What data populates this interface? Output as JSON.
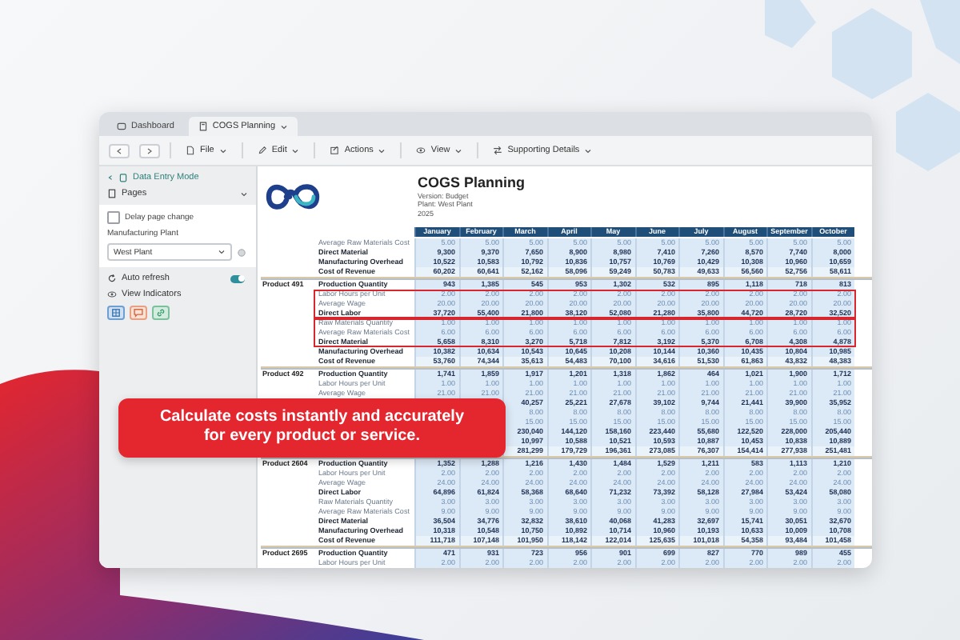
{
  "tabs": [
    {
      "label": "Dashboard",
      "selected": false
    },
    {
      "label": "COGS Planning",
      "selected": true
    }
  ],
  "toolbar": [
    {
      "label": "File",
      "kind": "file"
    },
    {
      "label": "Edit",
      "kind": "edit"
    },
    {
      "label": "Actions",
      "kind": "actions"
    },
    {
      "label": "View",
      "kind": "view"
    },
    {
      "label": "Supporting Details",
      "kind": "details"
    }
  ],
  "sidebar": {
    "mode_label": "Data Entry Mode",
    "pages_label": "Pages",
    "delay_page_change": {
      "label": "Delay page change",
      "checked": false
    },
    "plant_field": {
      "label": "Manufacturing Plant",
      "value": "West Plant"
    },
    "auto_refresh": {
      "label": "Auto refresh",
      "on": true
    },
    "view_indicators": {
      "label": "View Indicators"
    }
  },
  "report": {
    "title": "COGS Planning",
    "version": "Version: Budget",
    "plant": "Plant: West Plant",
    "year": "2025"
  },
  "columns": [
    "January",
    "February",
    "March",
    "April",
    "May",
    "June",
    "July",
    "August",
    "September",
    "October"
  ],
  "groups": [
    {
      "rows": [
        {
          "label": "Average Raw Materials Cost",
          "kind": "input",
          "values": [
            "5.00",
            "5.00",
            "5.00",
            "5.00",
            "5.00",
            "5.00",
            "5.00",
            "5.00",
            "5.00",
            "5.00"
          ]
        },
        {
          "label": "Direct Material",
          "kind": "calc",
          "values": [
            "9,300",
            "9,370",
            "7,650",
            "8,900",
            "8,980",
            "7,410",
            "7,260",
            "8,570",
            "7,740",
            "8,000"
          ]
        },
        {
          "label": "Manufacturing Overhead",
          "kind": "calc",
          "values": [
            "10,522",
            "10,583",
            "10,792",
            "10,836",
            "10,757",
            "10,769",
            "10,429",
            "10,308",
            "10,960",
            "10,659"
          ]
        },
        {
          "label": "Cost of Revenue",
          "kind": "total",
          "values": [
            "60,202",
            "60,641",
            "52,162",
            "58,096",
            "59,249",
            "50,783",
            "49,633",
            "56,560",
            "52,756",
            "58,611"
          ]
        }
      ]
    },
    {
      "product": "Product 491",
      "rows": [
        {
          "label": "Production Quantity",
          "kind": "calc",
          "values": [
            "943",
            "1,385",
            "545",
            "953",
            "1,302",
            "532",
            "895",
            "1,118",
            "718",
            "813"
          ]
        },
        {
          "kind": "outline",
          "rows": [
            {
              "label": "Labor Hours per Unit",
              "kind": "input",
              "values": [
                "2.00",
                "2.00",
                "2.00",
                "2.00",
                "2.00",
                "2.00",
                "2.00",
                "2.00",
                "2.00",
                "2.00"
              ]
            },
            {
              "label": "Average Wage",
              "kind": "input",
              "values": [
                "20.00",
                "20.00",
                "20.00",
                "20.00",
                "20.00",
                "20.00",
                "20.00",
                "20.00",
                "20.00",
                "20.00"
              ]
            },
            {
              "label": "Direct Labor",
              "kind": "calc",
              "values": [
                "37,720",
                "55,400",
                "21,800",
                "38,120",
                "52,080",
                "21,280",
                "35,800",
                "44,720",
                "28,720",
                "32,520"
              ]
            }
          ]
        },
        {
          "kind": "outline",
          "rows": [
            {
              "label": "Raw Materials Quantity",
              "kind": "input",
              "values": [
                "1.00",
                "1.00",
                "1.00",
                "1.00",
                "1.00",
                "1.00",
                "1.00",
                "1.00",
                "1.00",
                "1.00"
              ]
            },
            {
              "label": "Average Raw Materials Cost",
              "kind": "input",
              "values": [
                "6.00",
                "6.00",
                "6.00",
                "6.00",
                "6.00",
                "6.00",
                "6.00",
                "6.00",
                "6.00",
                "6.00"
              ]
            },
            {
              "label": "Direct Material",
              "kind": "calc",
              "values": [
                "5,658",
                "8,310",
                "3,270",
                "5,718",
                "7,812",
                "3,192",
                "5,370",
                "6,708",
                "4,308",
                "4,878"
              ]
            }
          ]
        },
        {
          "label": "Manufacturing Overhead",
          "kind": "calc",
          "values": [
            "10,382",
            "10,634",
            "10,543",
            "10,645",
            "10,208",
            "10,144",
            "10,360",
            "10,435",
            "10,804",
            "10,985"
          ]
        },
        {
          "label": "Cost of Revenue",
          "kind": "total",
          "values": [
            "53,760",
            "74,344",
            "35,613",
            "54,483",
            "70,100",
            "34,616",
            "51,530",
            "61,863",
            "43,832",
            "48,383"
          ]
        }
      ]
    },
    {
      "product": "Product 492",
      "rows": [
        {
          "label": "Production Quantity",
          "kind": "calc",
          "values": [
            "1,741",
            "1,859",
            "1,917",
            "1,201",
            "1,318",
            "1,862",
            "464",
            "1,021",
            "1,900",
            "1,712"
          ]
        },
        {
          "label": "Labor Hours per Unit",
          "kind": "input",
          "values": [
            "1.00",
            "1.00",
            "1.00",
            "1.00",
            "1.00",
            "1.00",
            "1.00",
            "1.00",
            "1.00",
            "1.00"
          ]
        },
        {
          "label": "Average Wage",
          "kind": "input",
          "values": [
            "21.00",
            "21.00",
            "21.00",
            "21.00",
            "21.00",
            "21.00",
            "21.00",
            "21.00",
            "21.00",
            "21.00"
          ]
        },
        {
          "kind": "calc",
          "values": [
            "40,257",
            "25,221",
            "27,678",
            "39,102",
            "9,744",
            "21,441",
            "39,900",
            "35,952"
          ]
        },
        {
          "kind": "input",
          "values": [
            "8.00",
            "8.00",
            "8.00",
            "8.00",
            "8.00",
            "8.00",
            "8.00",
            "8.00"
          ]
        },
        {
          "kind": "input",
          "values": [
            "15.00",
            "15.00",
            "15.00",
            "15.00",
            "15.00",
            "15.00",
            "15.00",
            "15.00"
          ]
        },
        {
          "kind": "calc",
          "values": [
            "230,040",
            "144,120",
            "158,160",
            "223,440",
            "55,680",
            "122,520",
            "228,000",
            "205,440"
          ]
        },
        {
          "kind": "calc",
          "values": [
            "10,997",
            "10,588",
            "10,521",
            "10,593",
            "10,887",
            "10,453",
            "10,838",
            "10,889"
          ]
        },
        {
          "kind": "total",
          "values": [
            "281,299",
            "179,729",
            "196,361",
            "273,085",
            "76,307",
            "154,414",
            "277,938",
            "251,481"
          ]
        }
      ]
    },
    {
      "product": "Product 2604",
      "rows": [
        {
          "label": "Production Quantity",
          "kind": "calc",
          "values": [
            "1,352",
            "1,288",
            "1,216",
            "1,430",
            "1,484",
            "1,529",
            "1,211",
            "583",
            "1,113",
            "1,210"
          ]
        },
        {
          "label": "Labor Hours per Unit",
          "kind": "input",
          "values": [
            "2.00",
            "2.00",
            "2.00",
            "2.00",
            "2.00",
            "2.00",
            "2.00",
            "2.00",
            "2.00",
            "2.00"
          ]
        },
        {
          "label": "Average Wage",
          "kind": "input",
          "values": [
            "24.00",
            "24.00",
            "24.00",
            "24.00",
            "24.00",
            "24.00",
            "24.00",
            "24.00",
            "24.00",
            "24.00"
          ]
        },
        {
          "label": "Direct Labor",
          "kind": "calc",
          "values": [
            "64,896",
            "61,824",
            "58,368",
            "68,640",
            "71,232",
            "73,392",
            "58,128",
            "27,984",
            "53,424",
            "58,080"
          ]
        },
        {
          "label": "Raw Materials Quantity",
          "kind": "input",
          "values": [
            "3.00",
            "3.00",
            "3.00",
            "3.00",
            "3.00",
            "3.00",
            "3.00",
            "3.00",
            "3.00",
            "3.00"
          ]
        },
        {
          "label": "Average Raw Materials Cost",
          "kind": "input",
          "values": [
            "9.00",
            "9.00",
            "9.00",
            "9.00",
            "9.00",
            "9.00",
            "9.00",
            "9.00",
            "9.00",
            "9.00"
          ]
        },
        {
          "label": "Direct Material",
          "kind": "calc",
          "values": [
            "36,504",
            "34,776",
            "32,832",
            "38,610",
            "40,068",
            "41,283",
            "32,697",
            "15,741",
            "30,051",
            "32,670"
          ]
        },
        {
          "label": "Manufacturing Overhead",
          "kind": "calc",
          "values": [
            "10,318",
            "10,548",
            "10,750",
            "10,892",
            "10,714",
            "10,960",
            "10,193",
            "10,633",
            "10,009",
            "10,708"
          ]
        },
        {
          "label": "Cost of Revenue",
          "kind": "total",
          "values": [
            "111,718",
            "107,148",
            "101,950",
            "118,142",
            "122,014",
            "125,635",
            "101,018",
            "54,358",
            "93,484",
            "101,458"
          ]
        }
      ]
    },
    {
      "product": "Product 2695",
      "rows": [
        {
          "label": "Production Quantity",
          "kind": "calc",
          "values": [
            "471",
            "931",
            "723",
            "956",
            "901",
            "699",
            "827",
            "770",
            "989",
            "455"
          ]
        },
        {
          "label": "Labor Hours per Unit",
          "kind": "input",
          "values": [
            "2.00",
            "2.00",
            "2.00",
            "2.00",
            "2.00",
            "2.00",
            "2.00",
            "2.00",
            "2.00",
            "2.00"
          ]
        }
      ]
    }
  ],
  "banner": {
    "text": "Calculate costs instantly and accurately for every product or service."
  }
}
